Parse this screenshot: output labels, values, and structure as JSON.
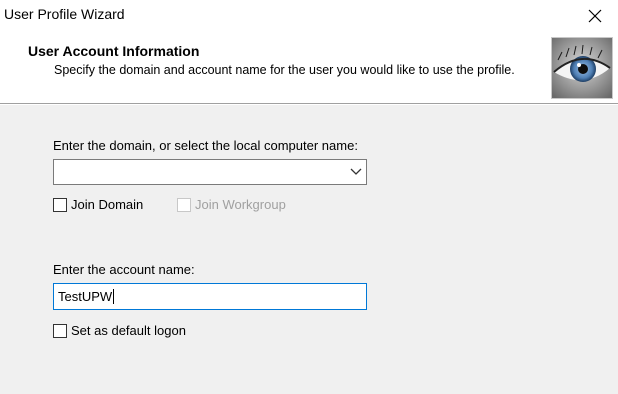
{
  "window": {
    "title": "User Profile Wizard",
    "close_icon": "close-icon"
  },
  "header": {
    "title": "User Account Information",
    "subtitle": "Specify the domain and account name for the user you would like to use the profile.",
    "image": "eye-image"
  },
  "domain_section": {
    "label": "Enter the domain, or select the local computer name:",
    "selected_value": "",
    "dropdown_icon": "chevron-down-icon",
    "join_domain": {
      "label": "Join Domain",
      "checked": false,
      "enabled": true
    },
    "join_workgroup": {
      "label": "Join Workgroup",
      "checked": false,
      "enabled": false
    }
  },
  "account_section": {
    "label": "Enter the account name:",
    "value": "TestUPW",
    "default_logon": {
      "label": "Set as default logon",
      "checked": false
    }
  },
  "colors": {
    "focus_border": "#0078d7",
    "disabled_text": "#a0a0a0",
    "dialog_bg": "#f0f0f0"
  }
}
